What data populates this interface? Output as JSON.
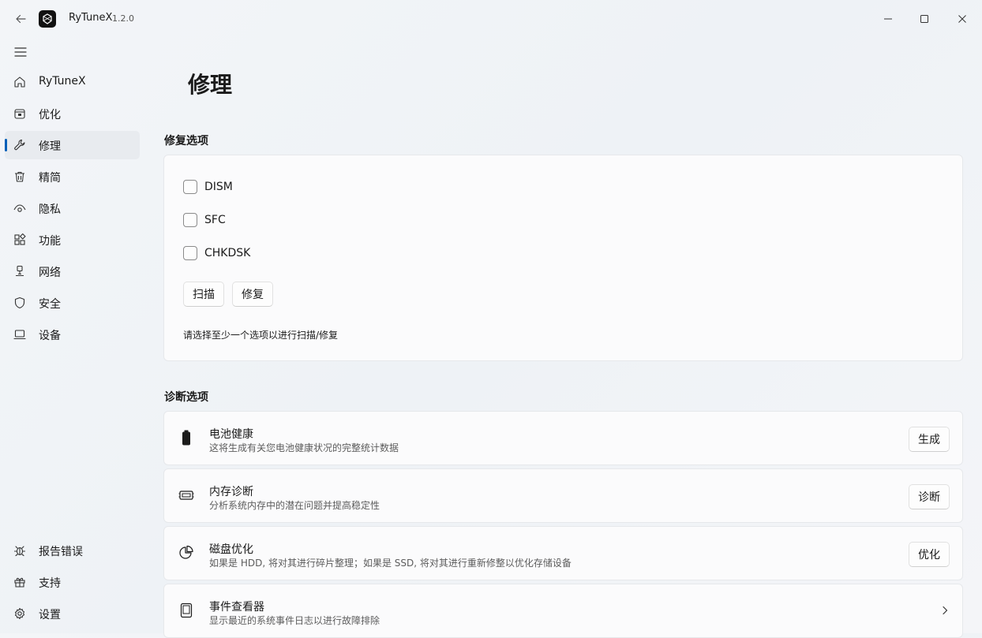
{
  "titlebar": {
    "app_name": "RyTuneX",
    "version": "1.2.0"
  },
  "nav": {
    "items": [
      {
        "id": "home",
        "label": "RyTuneX",
        "icon": "home-icon"
      },
      {
        "id": "optimize",
        "label": "优化",
        "icon": "toolbox-icon"
      },
      {
        "id": "repair",
        "label": "修理",
        "icon": "wrench-icon",
        "active": true
      },
      {
        "id": "debloat",
        "label": "精简",
        "icon": "trash-icon"
      },
      {
        "id": "privacy",
        "label": "隐私",
        "icon": "eye-icon"
      },
      {
        "id": "features",
        "label": "功能",
        "icon": "apps-icon"
      },
      {
        "id": "network",
        "label": "网络",
        "icon": "network-icon"
      },
      {
        "id": "security",
        "label": "安全",
        "icon": "shield-icon"
      },
      {
        "id": "device",
        "label": "设备",
        "icon": "laptop-icon"
      }
    ],
    "bottom_items": [
      {
        "id": "report",
        "label": "报告错误",
        "icon": "bug-icon"
      },
      {
        "id": "support",
        "label": "支持",
        "icon": "gift-icon"
      },
      {
        "id": "settings",
        "label": "设置",
        "icon": "gear-icon"
      }
    ]
  },
  "page": {
    "title": "修理"
  },
  "repair": {
    "section_title": "修复选项",
    "options": [
      {
        "label": "DISM",
        "checked": false
      },
      {
        "label": "SFC",
        "checked": false
      },
      {
        "label": "CHKDSK",
        "checked": false
      }
    ],
    "scan_label": "扫描",
    "repair_label": "修复",
    "hint": "请选择至少一个选项以进行扫描/修复"
  },
  "diagnostics": {
    "section_title": "诊断选项",
    "items": [
      {
        "title": "电池健康",
        "desc": "这将生成有关您电池健康状况的完整统计数据",
        "button": "生成",
        "icon": "battery-icon"
      },
      {
        "title": "内存诊断",
        "desc": "分析系统内存中的潜在问题并提高稳定性",
        "button": "诊断",
        "icon": "memory-icon"
      },
      {
        "title": "磁盘优化",
        "desc": "如果是 HDD, 将对其进行碎片整理；如果是 SSD, 将对其进行重新修整以优化存储设备",
        "button": "优化",
        "icon": "pie-chart-icon"
      },
      {
        "title": "事件查看器",
        "desc": "显示最近的系统事件日志以进行故障排除",
        "icon": "tablet-icon",
        "chevron": "chevron-right-icon"
      }
    ]
  },
  "colors": {
    "accent": "#005fb8",
    "card_bg": "#fbfbfc",
    "card_border": "#e6e8eb"
  }
}
